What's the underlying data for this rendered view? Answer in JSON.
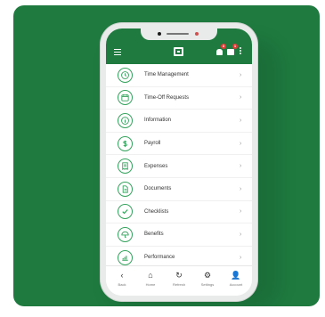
{
  "header": {
    "bell_badge": "3",
    "messages_badge": "1"
  },
  "menu": {
    "items": [
      {
        "label": "Time Management",
        "icon": "clock-icon"
      },
      {
        "label": "Time-Off Requests",
        "icon": "calendar-icon"
      },
      {
        "label": "Information",
        "icon": "info-icon"
      },
      {
        "label": "Payroll",
        "icon": "money-icon"
      },
      {
        "label": "Expenses",
        "icon": "receipt-icon"
      },
      {
        "label": "Documents",
        "icon": "document-icon"
      },
      {
        "label": "Checklists",
        "icon": "check-icon"
      },
      {
        "label": "Benefits",
        "icon": "umbrella-icon"
      },
      {
        "label": "Performance",
        "icon": "chart-icon"
      }
    ],
    "chevron": "›"
  },
  "bottom_nav": [
    {
      "label": "Back",
      "icon": "‹"
    },
    {
      "label": "Home",
      "icon": "⌂"
    },
    {
      "label": "Refresh",
      "icon": "↻"
    },
    {
      "label": "Settings",
      "icon": "⚙"
    },
    {
      "label": "Account",
      "icon": "👤"
    }
  ],
  "colors": {
    "brand_green": "#1e7a3f",
    "icon_green": "#35a35e",
    "badge_red": "#e53935"
  }
}
